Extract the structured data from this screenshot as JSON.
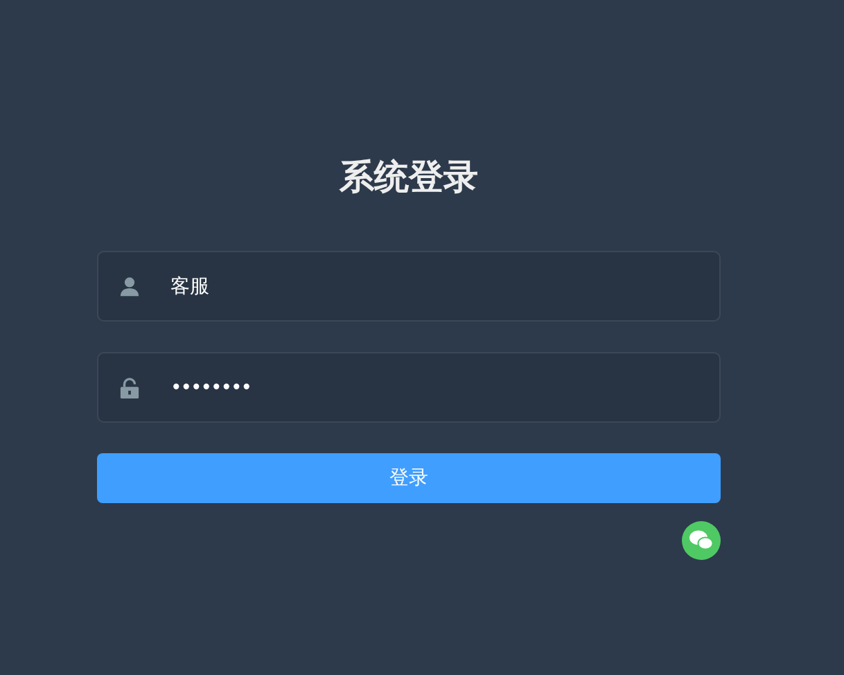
{
  "title": "系统登录",
  "fields": [
    {
      "kind": "user",
      "value": "客服"
    },
    {
      "kind": "password",
      "value": "••••••••"
    }
  ],
  "login_button": "登录",
  "social": [
    {
      "kind": "wechat"
    }
  ]
}
